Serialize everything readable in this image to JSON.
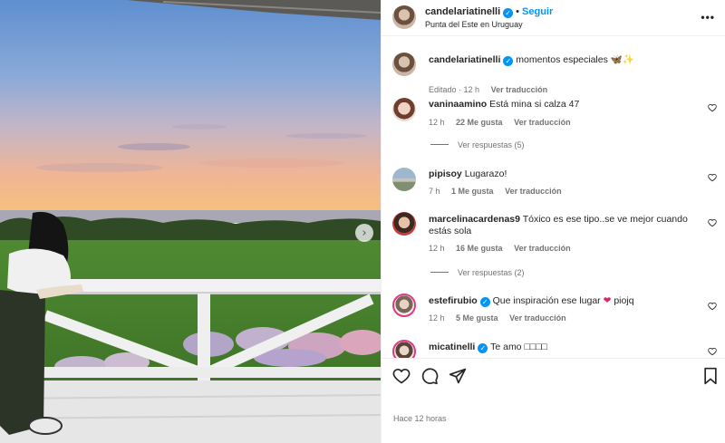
{
  "post": {
    "username": "candelariatinelli",
    "follow_label": "Seguir",
    "separator": "•",
    "location": "Punta del Este en Uruguay",
    "caption_text": "momentos especiales",
    "caption_emoji": "🦋✨",
    "edited_label": "Editado · 12 h",
    "translate_label": "Ver traducción",
    "posted_time": "Hace 12 horas"
  },
  "comments": [
    {
      "user": "vaninaamino",
      "text": "Está mina si calza 47",
      "time": "12 h",
      "likes": "22 Me gusta",
      "translate": "Ver traducción",
      "replies": "Ver respuestas (5)",
      "verified": false
    },
    {
      "user": "pipisoy",
      "text": "Lugarazo!",
      "time": "7 h",
      "likes": "1 Me gusta",
      "translate": "Ver traducción",
      "replies": "",
      "verified": false
    },
    {
      "user": "marcelinacardenas9",
      "text": "Tóxico es ese tipo..se ve mejor cuando estás sola",
      "time": "12 h",
      "likes": "16 Me gusta",
      "translate": "Ver traducción",
      "replies": "Ver respuestas (2)",
      "verified": false
    },
    {
      "user": "estefirubio",
      "text": "Que inspiración ese lugar",
      "text_after": "piojq",
      "time": "12 h",
      "likes": "5 Me gusta",
      "translate": "Ver traducción",
      "replies": "",
      "verified": true
    },
    {
      "user": "micatinelli",
      "text": "Te amo □□□□",
      "time": "",
      "likes": "",
      "translate": "",
      "replies": "",
      "verified": true
    }
  ],
  "icons": {
    "verified": "verified-badge-icon",
    "more": "more-options-icon",
    "like": "heart-icon",
    "comment": "comment-icon",
    "share": "send-icon",
    "save": "bookmark-icon",
    "next": "chevron-right-icon"
  },
  "colors": {
    "accent": "#0095f6",
    "muted": "#737373",
    "text": "#262626",
    "heart_red": "#e0245e"
  }
}
